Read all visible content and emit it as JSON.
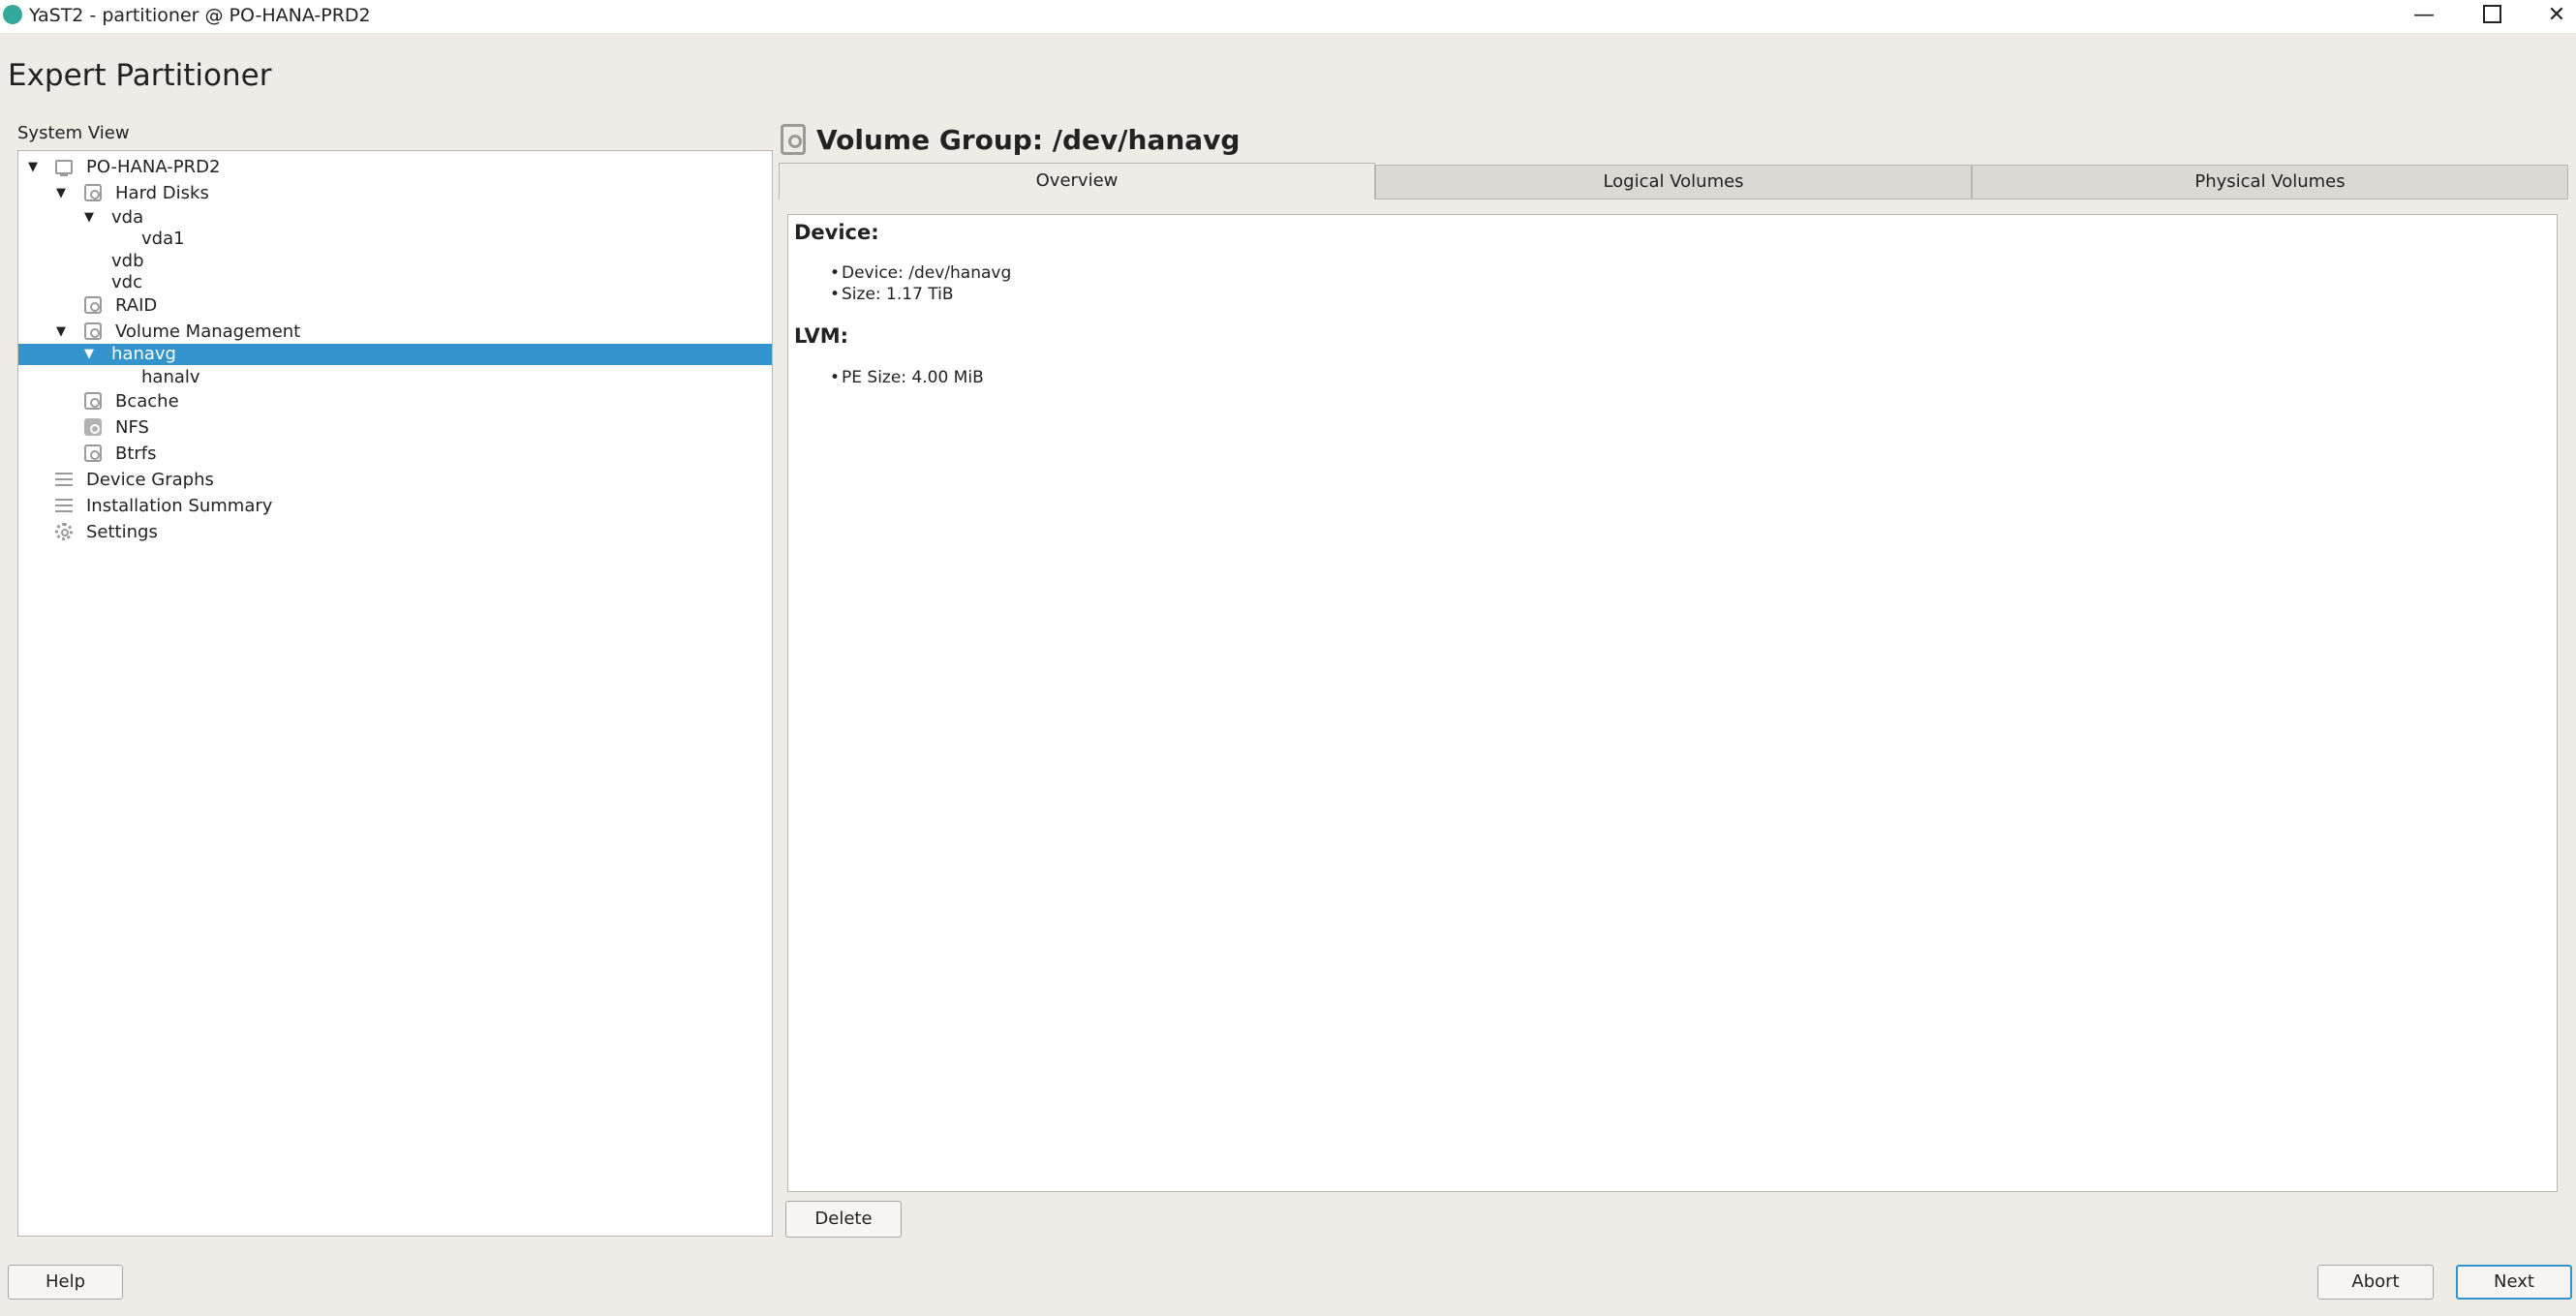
{
  "window": {
    "title": "YaST2 - partitioner @ PO-HANA-PRD2",
    "minimize_glyph": "—",
    "close_glyph": "✕"
  },
  "app_title": "Expert Partitioner",
  "system_view": {
    "label": "System View",
    "tree": [
      {
        "label": "PO-HANA-PRD2",
        "icon": "computer-icon",
        "expanded": true
      },
      {
        "label": "Hard Disks",
        "icon": "hard-disk-icon",
        "expanded": true
      },
      {
        "label": "vda",
        "expanded": true
      },
      {
        "label": "vda1"
      },
      {
        "label": "vdb"
      },
      {
        "label": "vdc"
      },
      {
        "label": "RAID",
        "icon": "raid-icon"
      },
      {
        "label": "Volume Management",
        "icon": "volume-management-icon",
        "expanded": true
      },
      {
        "label": "hanavg",
        "expanded": true,
        "selected": true
      },
      {
        "label": "hanalv"
      },
      {
        "label": "Bcache",
        "icon": "bcache-icon"
      },
      {
        "label": "NFS",
        "icon": "nfs-icon"
      },
      {
        "label": "Btrfs",
        "icon": "btrfs-icon"
      },
      {
        "label": "Device Graphs",
        "icon": "device-graphs-icon"
      },
      {
        "label": "Installation Summary",
        "icon": "installation-summary-icon"
      },
      {
        "label": "Settings",
        "icon": "settings-gear-icon"
      }
    ]
  },
  "volume_group": {
    "title": "Volume Group: /dev/hanavg",
    "icon": "volume-group-icon",
    "tabs": [
      {
        "label": "Overview",
        "active": true
      },
      {
        "label": "Logical Volumes",
        "active": false
      },
      {
        "label": "Physical Volumes",
        "active": false
      }
    ],
    "overview": {
      "device_heading": "Device:",
      "device_items": [
        "Device: /dev/hanavg",
        "Size: 1.17 TiB"
      ],
      "lvm_heading": "LVM:",
      "lvm_items": [
        "PE Size: 4.00 MiB"
      ]
    }
  },
  "buttons": {
    "delete": "Delete",
    "help": "Help",
    "abort": "Abort",
    "next": "Next"
  },
  "colors": {
    "selection": "#3393cd",
    "background": "#efebe7",
    "accent_icon": "#35a89b"
  }
}
